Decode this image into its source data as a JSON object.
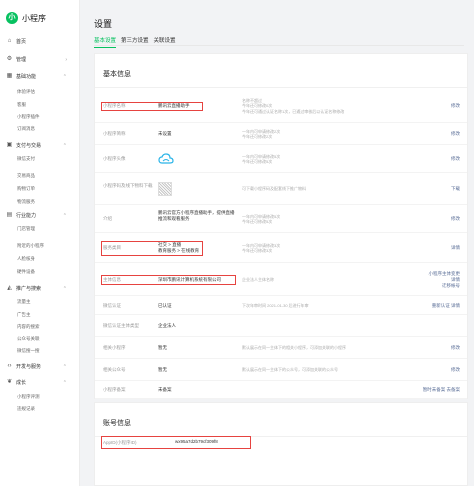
{
  "app": {
    "name": "小程序",
    "logo_glyph": "小"
  },
  "sidebar": {
    "items": [
      {
        "label": "首页",
        "icon": "home-icon",
        "type": "top"
      },
      {
        "label": "管理",
        "icon": "gear-icon",
        "type": "top"
      },
      {
        "label": "基础功能",
        "icon": "grid-icon",
        "type": "top"
      },
      {
        "label": "体验评估",
        "type": "sub"
      },
      {
        "label": "客服",
        "type": "sub"
      },
      {
        "label": "小程序插件",
        "type": "sub"
      },
      {
        "label": "订阅消息",
        "type": "sub"
      },
      {
        "label": "支付与交易",
        "icon": "wallet-icon",
        "type": "top"
      },
      {
        "label": "微信支付",
        "type": "sub"
      },
      {
        "label": "交易商品",
        "type": "sub"
      },
      {
        "label": "购物订单",
        "type": "sub"
      },
      {
        "label": "物流服务",
        "type": "sub"
      },
      {
        "label": "行业能力",
        "icon": "briefcase-icon",
        "type": "top"
      },
      {
        "label": "门店管理",
        "type": "sub"
      },
      {
        "label": "附近的小程序",
        "type": "sub"
      },
      {
        "label": "人脸核身",
        "type": "sub"
      },
      {
        "label": "硬件设备",
        "type": "sub"
      },
      {
        "label": "推广与搜索",
        "icon": "megaphone-icon",
        "type": "top"
      },
      {
        "label": "流量主",
        "type": "sub"
      },
      {
        "label": "广告主",
        "type": "sub"
      },
      {
        "label": "内容的搜索",
        "type": "sub"
      },
      {
        "label": "公众号关联",
        "type": "sub"
      },
      {
        "label": "微信搜一搜",
        "type": "sub"
      },
      {
        "label": "开发与服务",
        "icon": "code-icon",
        "type": "top"
      },
      {
        "label": "成长",
        "icon": "leaf-icon",
        "type": "top"
      },
      {
        "label": "小程序评测",
        "type": "sub"
      },
      {
        "label": "违规记录",
        "type": "sub"
      }
    ]
  },
  "page": {
    "title": "设置"
  },
  "tabs": [
    "基本设置",
    "第三方设置",
    "关联设置"
  ],
  "basic": {
    "title": "基本信息",
    "rows": [
      {
        "label": "小程序名称",
        "value": "鹏讯云直播助手",
        "desc": [
          "名称不超过",
          "今年还可修改0次",
          "今年还可通过认证名称1次，已通过审核后以认证名称修改"
        ],
        "action": "修改"
      },
      {
        "label": "小程序简称",
        "value": "未设置",
        "desc": [
          "一年内可申请修改2次",
          "今年还可修改2次"
        ],
        "action": "修改"
      },
      {
        "label": "小程序头像",
        "value": "",
        "desc": [
          "一年内可申请修改5次",
          "今年还可修改5次"
        ],
        "action": "修改"
      },
      {
        "label": "小程序码及线下物料下载",
        "value": "",
        "desc": [
          "可下载小程序码及配套线下推广物料"
        ],
        "action": "下载"
      },
      {
        "label": "介绍",
        "value": "鹏讯云官方小程序直播助手，提供直播推流和观看服务",
        "desc": [
          "一年内可申请修改5次",
          "今年还可修改5次"
        ],
        "action": "修改"
      },
      {
        "label": "服务类目",
        "value": "社交 > 直播\n教育服务 > 在线教育",
        "desc": [
          "一年内可申请修改3次",
          "今年还可修改3次"
        ],
        "action": "详情"
      },
      {
        "label": "主体信息",
        "value": "深圳市鹏讯计算机系统有限公司",
        "desc": [
          "企业法人主体名称"
        ],
        "action": "小程序主体变更\n详情\n迁移帐号"
      },
      {
        "label": "微信认证",
        "value": "已认证",
        "desc": [
          "下次年审时间 2021-01-30 后进行年审"
        ],
        "action": "重新认证  详情"
      },
      {
        "label": "微信认证主体类型",
        "value": "企业法人",
        "desc": [],
        "action": ""
      },
      {
        "label": "相关小程序",
        "value": "暂无",
        "desc": [
          "默认展示在同一主体下的相关小程序，可添加关联的小程序"
        ],
        "action": "修改"
      },
      {
        "label": "相关公众号",
        "value": "暂无",
        "desc": [
          "默认展示在同一主体下的公众号，可添加关联的公众号"
        ],
        "action": "修改"
      },
      {
        "label": "小程序备案",
        "value": "未备案",
        "desc": [],
        "action": "暂时未备案  去备案"
      }
    ]
  },
  "account": {
    "title": "账号信息",
    "appid_label": "AppID(小程序ID)",
    "appid_value": "wx95a7d2b79cf309f8"
  },
  "colors": {
    "accent": "#07c160",
    "link": "#576b95",
    "highlight": "#e64340"
  }
}
